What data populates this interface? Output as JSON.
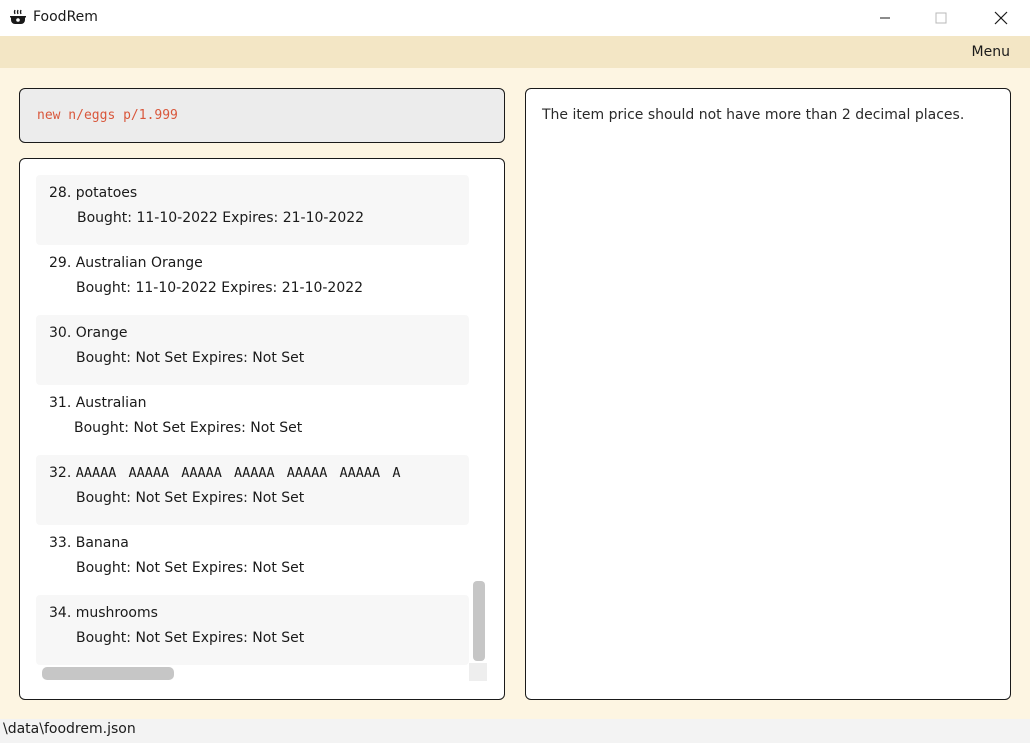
{
  "window": {
    "title": "FoodRem",
    "icon": "pot-icon"
  },
  "menubar": {
    "menu_label": "Menu"
  },
  "command_box": {
    "value": "new n/eggs p/1.999"
  },
  "result_display": {
    "message": "The item price should not have more than 2 decimal places."
  },
  "item_list": {
    "items": [
      {
        "index": "28.",
        "name": "potatoes",
        "details": "Bought: 11-10-2022  Expires: 21-10-2022"
      },
      {
        "index": "29.",
        "name": "Australian Orange",
        "details": "Bought: 11-10-2022  Expires: 21-10-2022"
      },
      {
        "index": "30.",
        "name": "Orange",
        "details": "Bought: Not Set  Expires: Not Set"
      },
      {
        "index": "31.",
        "name": "Australian",
        "details": "Bought: Not Set  Expires: Not Set"
      },
      {
        "index": "32.",
        "name": "AAAAA AAAAA AAAAA AAAAA AAAAA AAAAA A",
        "details": "Bought: Not Set  Expires: Not Set"
      },
      {
        "index": "33.",
        "name": "Banana",
        "details": "Bought: Not Set  Expires: Not Set"
      },
      {
        "index": "34.",
        "name": "mushrooms",
        "details": "Bought: Not Set  Expires: Not Set"
      }
    ]
  },
  "status_bar": {
    "path": "\\data\\foodrem.json"
  },
  "colors": {
    "menubar": "#f3e6c5",
    "background": "#fdf5e2",
    "command_text": "#d9573b"
  }
}
